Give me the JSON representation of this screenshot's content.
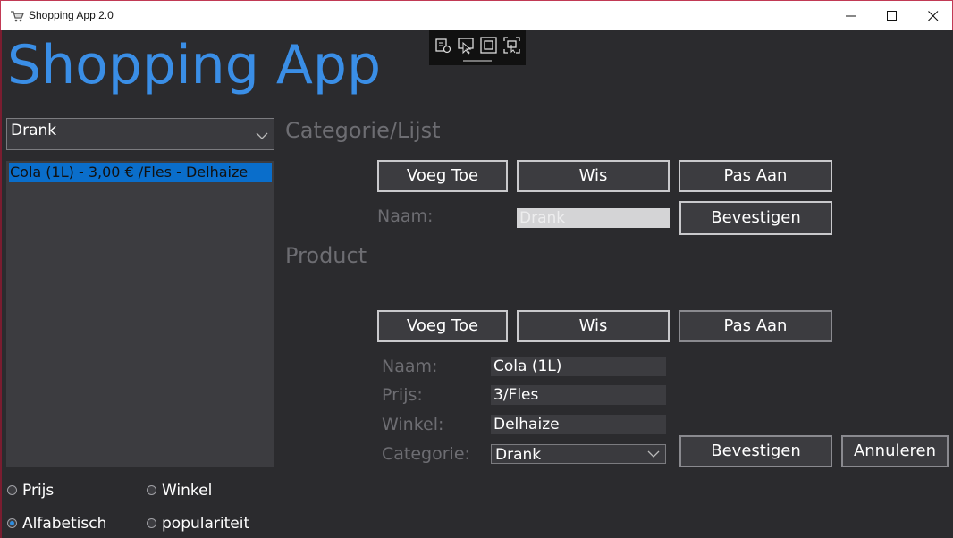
{
  "window": {
    "title": "Shopping App 2.0",
    "icon": "cart-icon",
    "controls": [
      "minimize-icon",
      "maximize-icon",
      "close-icon"
    ]
  },
  "debug_toolbar": {
    "icons": [
      "live-visual-tree-icon",
      "select-element-icon",
      "display-layout-adorners-icon",
      "track-focused-element-icon"
    ]
  },
  "app_title": "Shopping App",
  "category_dropdown": {
    "selected": "Drank"
  },
  "product_list": {
    "items": [
      "Cola (1L) - 3,00 € /Fles - Delhaize"
    ],
    "selected_index": 0
  },
  "category_section": {
    "heading": "Categorie/Lijst",
    "add_label": "Voeg Toe",
    "delete_label": "Wis",
    "edit_label": "Pas Aan",
    "name_label": "Naam:",
    "name_value": "Drank",
    "confirm_label": "Bevestigen"
  },
  "product_section": {
    "heading": "Product",
    "add_label": "Voeg Toe",
    "delete_label": "Wis",
    "edit_label": "Pas Aan",
    "name_label": "Naam:",
    "name_value": "Cola (1L)",
    "price_label": "Prijs:",
    "price_value": "3/Fles",
    "store_label": "Winkel:",
    "store_value": "Delhaize",
    "category_label": "Categorie:",
    "category_value": "Drank",
    "confirm_label": "Bevestigen",
    "cancel_label": "Annuleren"
  },
  "sort_options": {
    "price": "Prijs",
    "store": "Winkel",
    "alphabetical": "Alfabetisch",
    "popularity": "populariteit",
    "selected": "alphabetical"
  },
  "colors": {
    "accent": "#3a8ee6",
    "selection": "#0a6ecb",
    "background": "#2b2b2e"
  }
}
